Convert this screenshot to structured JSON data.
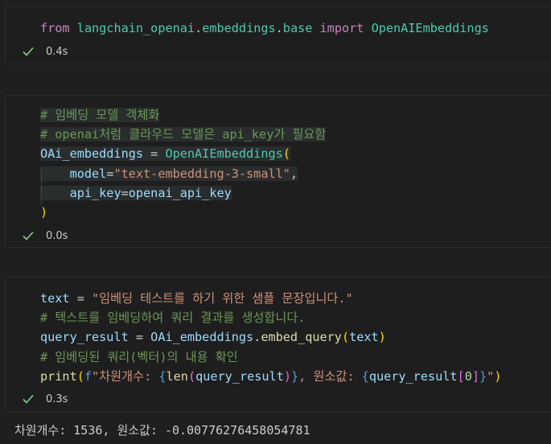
{
  "cells": [
    {
      "status_time": "0.4s",
      "lines": [
        [
          {
            "t": "from",
            "c": "kw"
          },
          {
            "t": " ",
            "c": "punc"
          },
          {
            "t": "langchain_openai",
            "c": "mod"
          },
          {
            "t": ".",
            "c": "punc"
          },
          {
            "t": "embeddings",
            "c": "mod"
          },
          {
            "t": ".",
            "c": "punc"
          },
          {
            "t": "base",
            "c": "mod"
          },
          {
            "t": " ",
            "c": "punc"
          },
          {
            "t": "import",
            "c": "kw"
          },
          {
            "t": " ",
            "c": "punc"
          },
          {
            "t": "OpenAIEmbeddings",
            "c": "cls"
          }
        ]
      ]
    },
    {
      "status_time": "0.0s",
      "lines": [
        [
          {
            "t": "# 임베딩 모델 객체화",
            "c": "cmt hl"
          }
        ],
        [
          {
            "t": "# openai처럼 클라우드 모델은 api_key가 필요함",
            "c": "cmt hl"
          }
        ],
        [
          {
            "t": "OAi_embeddings",
            "c": "var hl"
          },
          {
            "t": " = ",
            "c": "punc hl"
          },
          {
            "t": "OpenAIEmbeddings",
            "c": "cls hl"
          },
          {
            "t": "(",
            "c": "brace hl"
          }
        ],
        [
          {
            "t": "    ",
            "c": "punc hl"
          },
          {
            "t": "model",
            "c": "var hl"
          },
          {
            "t": "=",
            "c": "punc hl"
          },
          {
            "t": "\"text-embedding-3-small\"",
            "c": "str hl"
          },
          {
            "t": ",",
            "c": "punc hl"
          }
        ],
        [
          {
            "t": "    ",
            "c": "punc hl"
          },
          {
            "t": "api_key",
            "c": "var hl"
          },
          {
            "t": "=",
            "c": "punc hl"
          },
          {
            "t": "openai_api_key",
            "c": "var hl"
          }
        ],
        [
          {
            "t": ")",
            "c": "brace"
          }
        ]
      ]
    },
    {
      "status_time": "0.3s",
      "lines": [
        [
          {
            "t": "text",
            "c": "var"
          },
          {
            "t": " = ",
            "c": "punc"
          },
          {
            "t": "\"임베딩 테스트를 하기 위한 샘플 문장입니다.\"",
            "c": "str"
          }
        ],
        [
          {
            "t": "# 텍스트를 임베딩하여 쿼리 결과를 생성합니다.",
            "c": "cmt"
          }
        ],
        [
          {
            "t": "query_result",
            "c": "var"
          },
          {
            "t": " = ",
            "c": "punc"
          },
          {
            "t": "OAi_embeddings",
            "c": "var"
          },
          {
            "t": ".",
            "c": "punc"
          },
          {
            "t": "embed_query",
            "c": "fn"
          },
          {
            "t": "(",
            "c": "brace"
          },
          {
            "t": "text",
            "c": "var"
          },
          {
            "t": ")",
            "c": "brace"
          }
        ],
        [
          {
            "t": "# 임베딩된 쿼리(벡터)의 내용 확인",
            "c": "cmt"
          }
        ],
        [
          {
            "t": "print",
            "c": "fn"
          },
          {
            "t": "(",
            "c": "brace"
          },
          {
            "t": "f",
            "c": "fstr-brace"
          },
          {
            "t": "\"차원개수: ",
            "c": "str"
          },
          {
            "t": "{",
            "c": "fstr-brace"
          },
          {
            "t": "len",
            "c": "fn"
          },
          {
            "t": "(",
            "c": "brace2"
          },
          {
            "t": "query_result",
            "c": "var"
          },
          {
            "t": ")",
            "c": "brace2"
          },
          {
            "t": "}",
            "c": "fstr-brace"
          },
          {
            "t": ", 원소값: ",
            "c": "str"
          },
          {
            "t": "{",
            "c": "fstr-brace"
          },
          {
            "t": "query_result",
            "c": "var"
          },
          {
            "t": "[",
            "c": "brace2"
          },
          {
            "t": "0",
            "c": "num"
          },
          {
            "t": "]",
            "c": "brace2"
          },
          {
            "t": "}",
            "c": "fstr-brace"
          },
          {
            "t": "\"",
            "c": "str"
          },
          {
            "t": ")",
            "c": "brace"
          }
        ]
      ]
    }
  ],
  "output_text": "차원개수: 1536, 원소값: -0.00776276458054781"
}
